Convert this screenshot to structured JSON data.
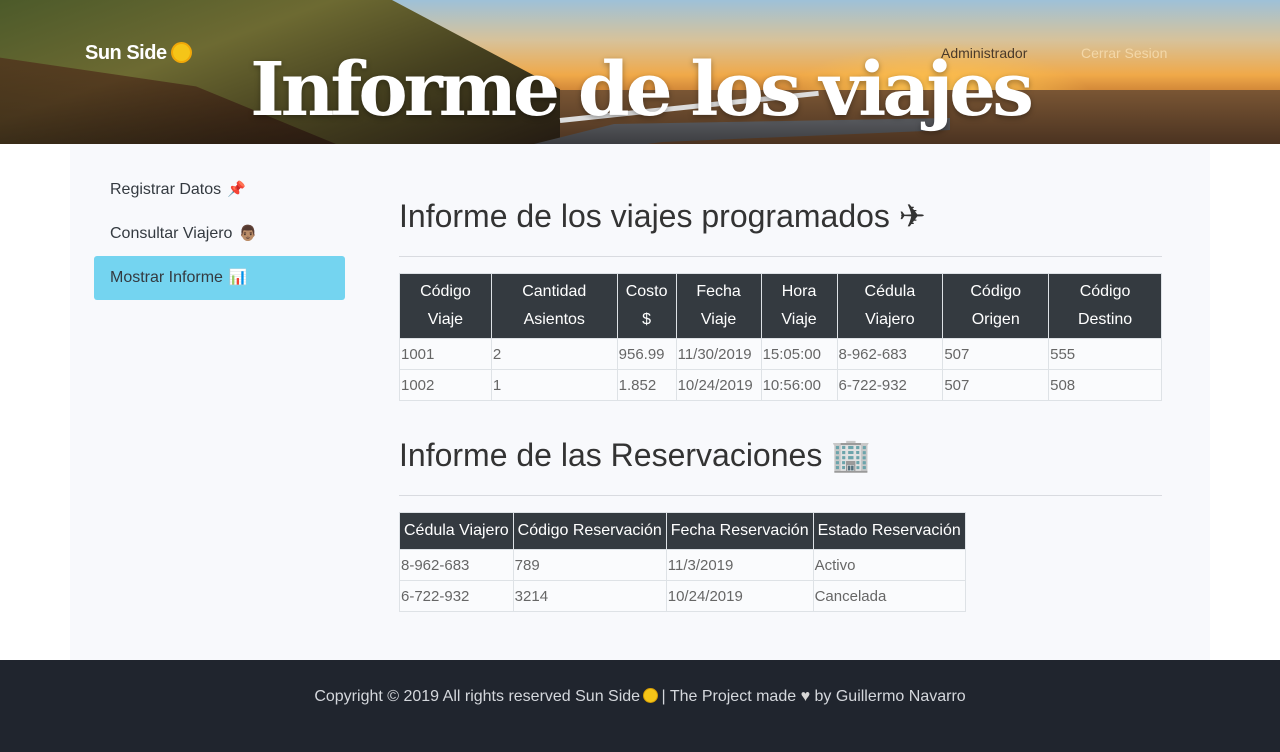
{
  "header": {
    "brand": "Sun Side",
    "brand_icon": "sun-icon",
    "title": "Informe de los viajes",
    "nav": {
      "admin": "Administrador",
      "logout": "Cerrar Sesion"
    }
  },
  "sidebar": {
    "items": [
      {
        "label": "Registrar Datos",
        "icon": "pushpin-icon",
        "emoji": "📌",
        "active": false
      },
      {
        "label": "Consultar Viajero",
        "icon": "person-icon",
        "emoji": "👨🏽",
        "active": false
      },
      {
        "label": "Mostrar Informe",
        "icon": "bar-chart-icon",
        "emoji": "📊",
        "active": true
      }
    ],
    "active_color": "#74d4f0"
  },
  "trips": {
    "title": "Informe de los viajes programados ✈",
    "columns": [
      [
        "Código",
        "Viaje"
      ],
      [
        "Cantidad",
        "Asientos"
      ],
      [
        "Costo",
        "$"
      ],
      [
        "Fecha",
        "Viaje"
      ],
      [
        "Hora",
        "Viaje"
      ],
      [
        "Cédula",
        "Viajero"
      ],
      [
        "Código",
        "Origen"
      ],
      [
        "Código",
        "Destino"
      ]
    ],
    "rows": [
      [
        "1001",
        "2",
        "956.99",
        "11/30/2019",
        "15:05:00",
        "8-962-683",
        "507",
        "555"
      ],
      [
        "1002",
        "1",
        "1.852",
        "10/24/2019",
        "10:56:00",
        "6-722-932",
        "507",
        "508"
      ]
    ]
  },
  "reservations": {
    "title": "Informe de las Reservaciones 🏢",
    "columns": [
      "Cédula Viajero",
      "Código Reservación",
      "Fecha Reservación",
      "Estado Reservación"
    ],
    "rows": [
      [
        "8-962-683",
        "789",
        "11/3/2019",
        "Activo"
      ],
      [
        "6-722-932",
        "3214",
        "10/24/2019",
        "Cancelada"
      ]
    ]
  },
  "footer": {
    "text_before": "Copyright © 2019 All rights reserved Sun Side",
    "text_middle": " | The Project made ",
    "text_after": " by Guillermo Navarro",
    "heart": "♥"
  },
  "colors": {
    "header_dark": "#343a40",
    "footer_bg": "#20252e",
    "panel_bg": "#f8f9fc"
  }
}
